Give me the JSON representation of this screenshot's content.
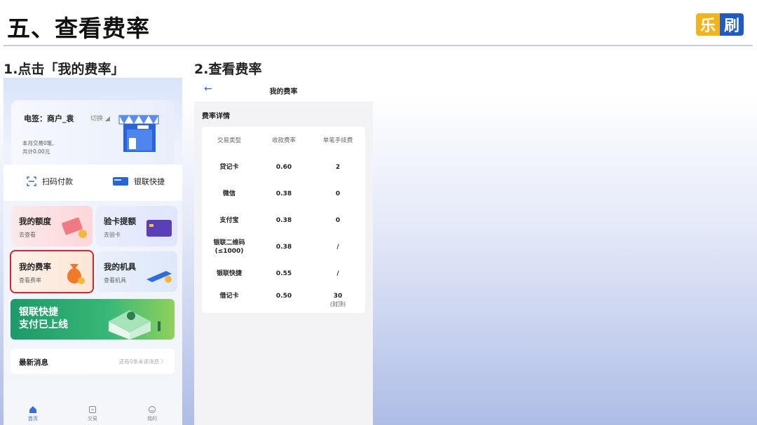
{
  "slide": {
    "title": "五、查看费率",
    "logo_char_1": "乐",
    "logo_char_2": "刷"
  },
  "steps": {
    "step1": "1.点击「我的费率」",
    "step2": "2.查看费率"
  },
  "home_screen": {
    "merchant_name": "电签：商户_袁",
    "switch_label": "切换 ◢",
    "tx_count": "本月交易0笔,",
    "tx_total": "共计0.00元",
    "quick_actions": [
      "扫码付款",
      "银联快捷"
    ],
    "tiles": [
      {
        "title": "我的额度",
        "subtitle": "去查看"
      },
      {
        "title": "验卡提额",
        "subtitle": "去验卡"
      },
      {
        "title": "我的费率",
        "subtitle": "查看费率"
      },
      {
        "title": "我的机具",
        "subtitle": "查看机具"
      }
    ],
    "banner": {
      "line1": "银联快捷",
      "line2": "支付已上线"
    },
    "news": {
      "title": "最新消息",
      "subtitle": "还有0条未读消息 〉"
    },
    "nav": [
      "首页",
      "交易",
      "我的"
    ]
  },
  "rate_screen": {
    "title": "我的费率",
    "section_title": "费率详情",
    "columns": [
      "交易类型",
      "收款费率",
      "单笔手续费"
    ],
    "rows": [
      {
        "type": "贷记卡",
        "rate": "0.60",
        "fee": "2",
        "note": ""
      },
      {
        "type": "微信",
        "rate": "0.38",
        "fee": "0",
        "note": ""
      },
      {
        "type": "支付宝",
        "rate": "0.38",
        "fee": "0",
        "note": ""
      },
      {
        "type": "银联二维码\n(≤1000)",
        "rate": "0.38",
        "fee": "/",
        "note": ""
      },
      {
        "type": "银联快捷",
        "rate": "0.55",
        "fee": "/",
        "note": ""
      },
      {
        "type": "借记卡",
        "rate": "0.50",
        "fee": "30",
        "note": "(封顶)"
      }
    ]
  },
  "colors": {
    "accent_blue": "#2f6ce0",
    "highlight_red": "#d9262b",
    "banner_green": "#1c9a68",
    "logo_yellow": "#f3b31a",
    "logo_blue": "#1e5bc6"
  }
}
